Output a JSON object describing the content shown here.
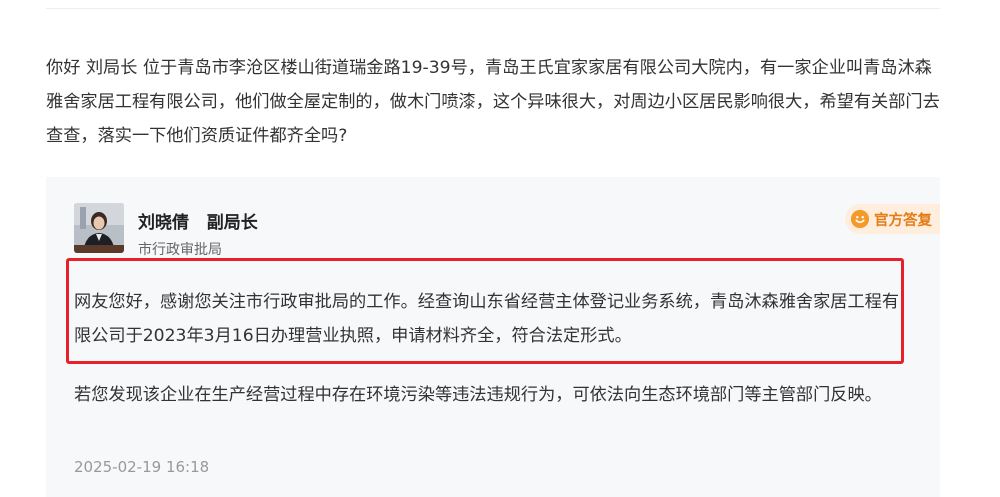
{
  "question": {
    "text": "你好 刘局长 位于青岛市李沧区楼山街道瑞金路19-39号，青岛王氏宜家家居有限公司大院内，有一家企业叫青岛沐森雅舍家居工程有限公司，他们做全屋定制的，做木门喷漆，这个异味很大，对周边小区居民影响很大，希望有关部门去查查，落实一下他们资质证件都齐全吗?"
  },
  "reply": {
    "name": "刘晓倩   副局长",
    "department": "市行政审批局",
    "badge_label": "官方答复",
    "badge_icon": "smile-icon",
    "paragraph_1": "网友您好，感谢您关注市行政审批局的工作。经查询山东省经营主体登记业务系统，青岛沐森雅舍家居工程有限公司于2023年3月16日办理营业执照，申请材料齐全，符合法定形式。",
    "paragraph_2": "若您发现该企业在生产经营过程中存在环境污染等违法违规行为，可依法向生态环境部门等主管部门反映。",
    "time": "2025-02-19 16:18"
  },
  "colors": {
    "highlight_border": "#e8202a",
    "badge_text": "#e57c1a",
    "badge_bg": "#ffeedd",
    "card_bg": "#f7f8fa"
  }
}
